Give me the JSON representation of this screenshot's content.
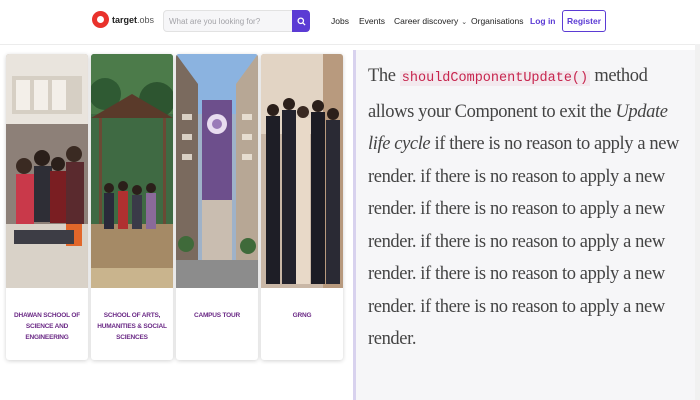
{
  "header": {
    "logo_text": "target",
    "logo_sub": ".obs",
    "search": {
      "placeholder": "What are you looking for?"
    },
    "nav": {
      "jobs": "Jobs",
      "events": "Events",
      "career_discovery": "Career discovery",
      "organisations": "Organisations"
    },
    "login_label": "Log in",
    "register_label": "Register"
  },
  "colors": {
    "accent": "#5b3bd4",
    "logo": "#e9322c",
    "card_title": "#6b2a86",
    "code": "#c7254e"
  },
  "cards": [
    {
      "title": "DHAWAN SCHOOL OF SCIENCE AND ENGINEERING"
    },
    {
      "title": "SCHOOL OF ARTS, HUMANITIES & SOCIAL SCIENCES"
    },
    {
      "title": "CAMPUS TOUR"
    },
    {
      "title": "GRNG"
    }
  ],
  "article": {
    "p1": "The",
    "code": "shouldComponentUpdate()",
    "p2": "method allows your Component to exit the",
    "italic": "Update life cycle",
    "p3": "if there is no reason to apply a new render. if there is no reason to apply a new render. if there is no reason to apply a new render. if there is no reason to apply a new render. if there is no reason to apply a new render. if there is no reason to apply a new render."
  }
}
